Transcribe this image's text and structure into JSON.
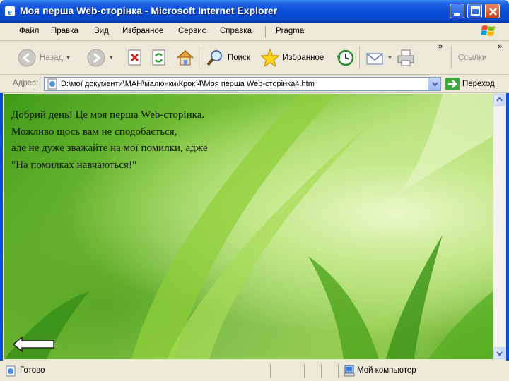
{
  "window": {
    "title": "Моя перша Web-сторінка - Microsoft Internet Explorer"
  },
  "menu": {
    "items": [
      "Файл",
      "Правка",
      "Вид",
      "Избранное",
      "Сервис",
      "Справка",
      "Pragma"
    ]
  },
  "toolbar": {
    "back_label": "Назад",
    "search_label": "Поиск",
    "favorites_label": "Избранное",
    "links_label": "Ссылки",
    "chevron": "»"
  },
  "address": {
    "label": "Адрес:",
    "value": "D:\\мої документи\\МАН\\малюнки\\Крок 4\\Моя перша Web-сторінка4.htm",
    "go_label": "Переход"
  },
  "page": {
    "lines": [
      "Добрий день! Це моя перша Web-сторінка.",
      "Можливо щось вам не сподобається,",
      "але не дуже зважайте на мої помилки, адже",
      "\"На помилках навчаються!\""
    ]
  },
  "status": {
    "text": "Готово",
    "zone": "Мой компьютер"
  },
  "colors": {
    "titlebar": "#0a4ed8",
    "chrome": "#ece9d8",
    "page_green": "#7cc43a"
  }
}
